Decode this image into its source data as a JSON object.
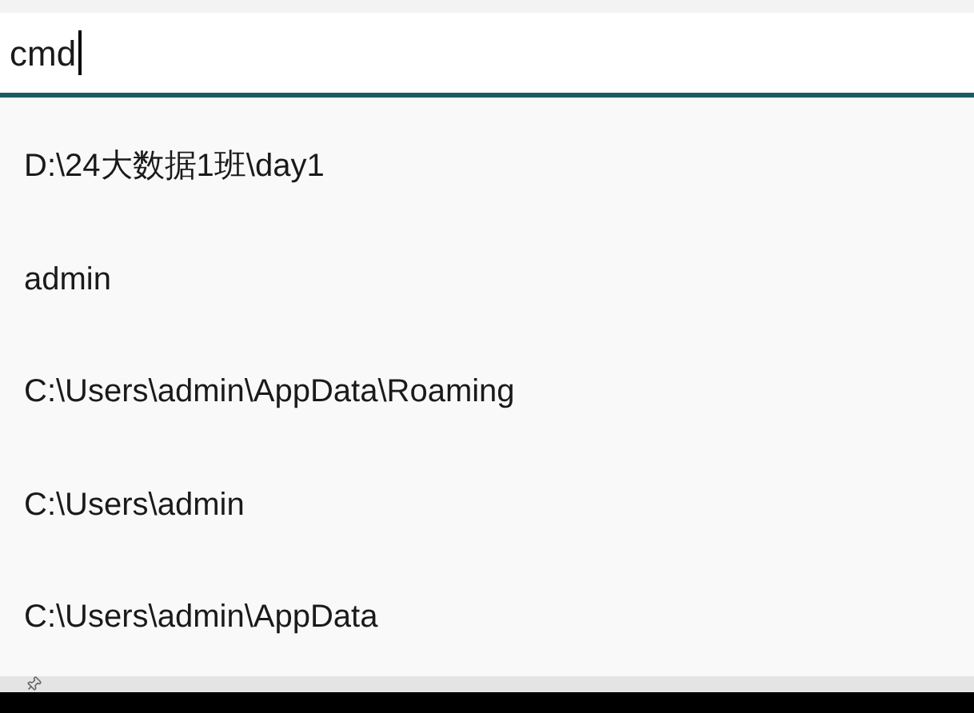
{
  "address_bar": {
    "value": "cmd"
  },
  "suggestions": [
    {
      "text": "D:\\24大数据1班\\day1"
    },
    {
      "text": "admin"
    },
    {
      "text": "C:\\Users\\admin\\AppData\\Roaming"
    },
    {
      "text": "C:\\Users\\admin"
    },
    {
      "text": "C:\\Users\\admin\\AppData"
    }
  ]
}
